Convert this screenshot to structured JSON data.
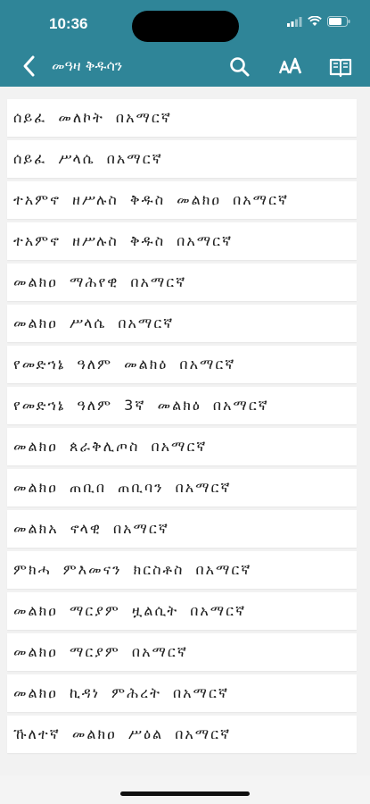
{
  "status_bar": {
    "time": "10:36"
  },
  "header": {
    "title": "መዓዛ ቅዱሳን"
  },
  "list": {
    "items": [
      {
        "label": "ሰይፈ መለኮት በአማርኛ"
      },
      {
        "label": "ሰይፈ ሥላሴ በአማርኛ"
      },
      {
        "label": "ተአምኖ ዘሥሉስ ቅዱስ መልክዐ በአማርኛ"
      },
      {
        "label": "ተአምኖ ዘሥሉስ ቅዱስ በአማርኛ"
      },
      {
        "label": "መልክዐ ማሕየዊ በአማርኛ"
      },
      {
        "label": "መልክዐ ሥላሴ በአማርኛ"
      },
      {
        "label": "የመድኀኔ ዓለም መልክዕ በአማርኛ"
      },
      {
        "label": "የመድኀኔ ዓለም 3ኛ መልክዕ በአማርኛ"
      },
      {
        "label": "መልክዐ ጰራቅሊጦስ በአማርኛ"
      },
      {
        "label": "መልክዐ ጠቢበ ጠቢባን በአማርኛ"
      },
      {
        "label": "መልክአ ኖላዊ በአማርኛ"
      },
      {
        "label": "ምክሓ ምእመናን ክርስቶስ በአማርኛ"
      },
      {
        "label": "መልክዐ ማርያም ዟልሲት በአማርኛ"
      },
      {
        "label": "መልክዐ ማርያም በአማርኛ"
      },
      {
        "label": "መልክዐ ኪዳነ ምሕረት በአማርኛ"
      },
      {
        "label": "ኹለተኛ መልክዐ ሥዕል በአማርኛ"
      }
    ]
  },
  "colors": {
    "header_bg": "#2f8598",
    "row_bg": "#ffffff",
    "page_bg": "#f2f2f2"
  }
}
